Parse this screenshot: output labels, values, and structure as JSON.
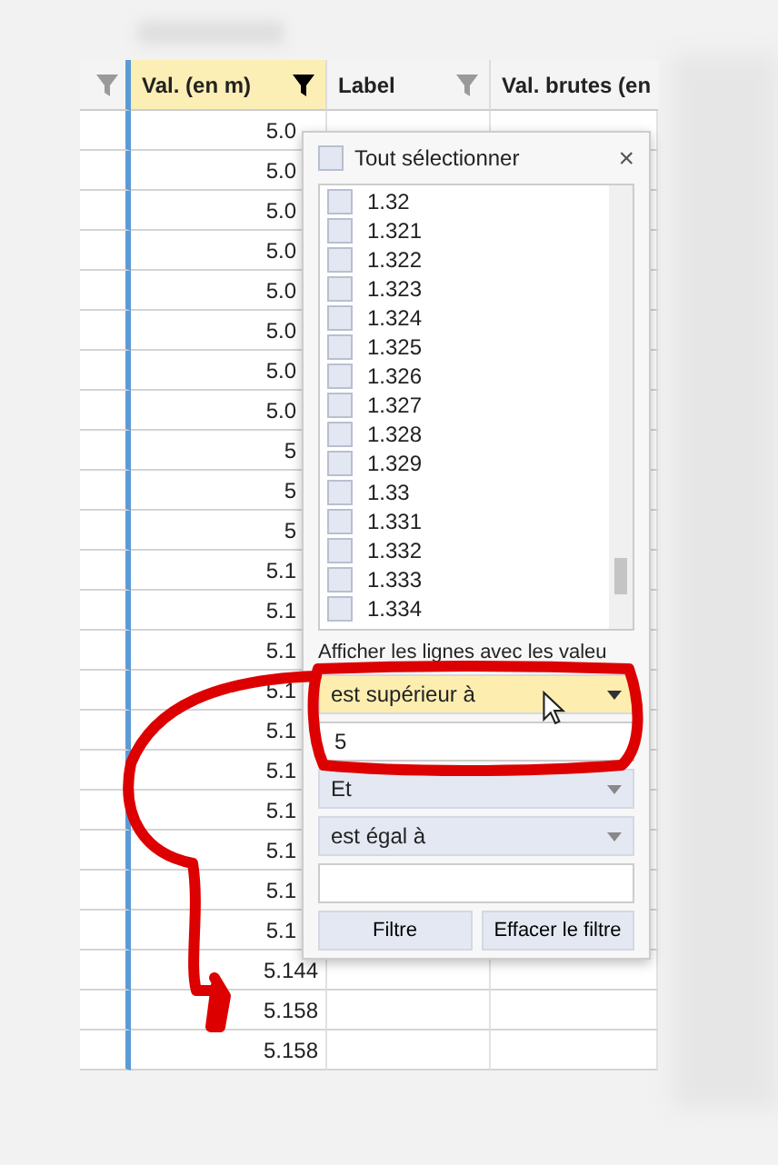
{
  "table": {
    "columns": [
      {
        "filter_active": false,
        "selected": false
      },
      {
        "label": "Val. (en m)",
        "filter_active": true,
        "selected": true
      },
      {
        "label": "Label",
        "filter_active": false,
        "selected": false
      },
      {
        "label": "Val. brutes (en",
        "selected": false
      }
    ],
    "rows": [
      "5.0",
      "5.0",
      "5.0",
      "5.0",
      "5.0",
      "5.0",
      "5.0",
      "5.0",
      "5",
      "5",
      "5",
      "5.1",
      "5.1",
      "5.1",
      "5.1",
      "5.1",
      "5.1",
      "5.1",
      "5.1",
      "5.1",
      "5.1",
      "5.144",
      "5.158",
      "5.158"
    ]
  },
  "filter_popup": {
    "select_all": {
      "label": "Tout sélectionner",
      "checked": false
    },
    "close": "×",
    "values": [
      {
        "label": "1.32",
        "checked": false
      },
      {
        "label": "1.321",
        "checked": false
      },
      {
        "label": "1.322",
        "checked": false
      },
      {
        "label": "1.323",
        "checked": false
      },
      {
        "label": "1.324",
        "checked": false
      },
      {
        "label": "1.325",
        "checked": false
      },
      {
        "label": "1.326",
        "checked": false
      },
      {
        "label": "1.327",
        "checked": false
      },
      {
        "label": "1.328",
        "checked": false
      },
      {
        "label": "1.329",
        "checked": false
      },
      {
        "label": "1.33",
        "checked": false
      },
      {
        "label": "1.331",
        "checked": false
      },
      {
        "label": "1.332",
        "checked": false
      },
      {
        "label": "1.333",
        "checked": false
      },
      {
        "label": "1.334",
        "checked": false
      }
    ],
    "condition_label": "Afficher les lignes avec les valeu",
    "condition1": {
      "value": "est supérieur à",
      "highlighted": true
    },
    "value1": "5",
    "logic": {
      "value": "Et",
      "highlighted": false
    },
    "condition2": {
      "value": "est égal à",
      "highlighted": false
    },
    "buttons": [
      "Filtre",
      "Effacer le filtre"
    ]
  }
}
